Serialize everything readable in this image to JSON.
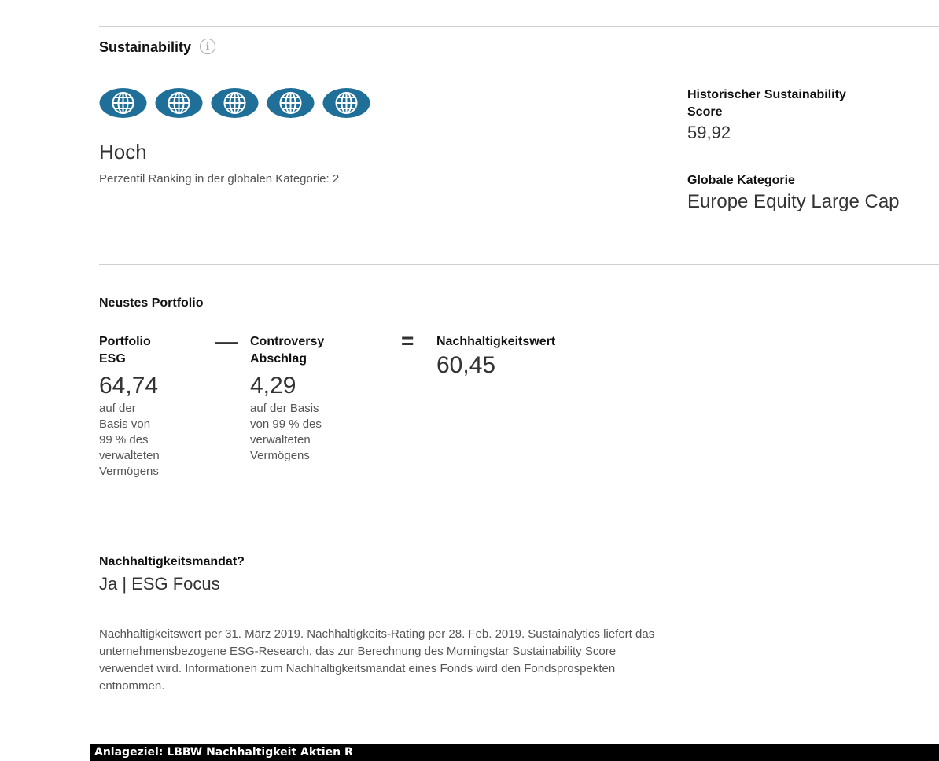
{
  "sustainability": {
    "title": "Sustainability",
    "info_icon": "i",
    "globe_count": 5,
    "globe_color": "#1f6f99",
    "rating_text": "Hoch",
    "percentile_text": "Perzentil Ranking in der globalen Kategorie: 2",
    "historic_label_line1": "Historischer Sustainability",
    "historic_label_line2": "Score",
    "historic_value": "59,92",
    "category_label": "Globale Kategorie",
    "category_value": "Europe Equity Large Cap"
  },
  "portfolio": {
    "title": "Neustes Portfolio",
    "esg_label_line1": "Portfolio",
    "esg_label_line2": "ESG",
    "esg_value": "64,74",
    "esg_desc": [
      "auf der",
      "Basis von",
      "99 % des",
      "verwalteten",
      "Vermögens"
    ],
    "minus": "—",
    "controversy_label_line1": "Controversy",
    "controversy_label_line2": "Abschlag",
    "controversy_value": "4,29",
    "controversy_desc": [
      "auf der Basis",
      "von 99 % des",
      "verwalteten",
      "Vermögens"
    ],
    "equals": "=",
    "result_label": "Nachhaltigkeitswert",
    "result_value": "60,45"
  },
  "mandate": {
    "label": "Nachhaltigkeitsmandat?",
    "value": "Ja | ESG Focus"
  },
  "note": {
    "line1": "Nachhaltigkeitswert per 31. März 2019. Nachhaltigkeits-Rating per 28. Feb. 2019. Sustainalytics liefert das",
    "line2": "unternehmensbezogene ESG-Research, das zur Berechnung des Morningstar Sustainability Score",
    "line3": "verwendet wird. Informationen zum Nachhaltigkeitsmandat eines Fonds wird den Fondsprospekten",
    "line4": "entnommen."
  },
  "footer_bar": {
    "text": "Anlageziel: LBBW Nachhaltigkeit Aktien R"
  }
}
